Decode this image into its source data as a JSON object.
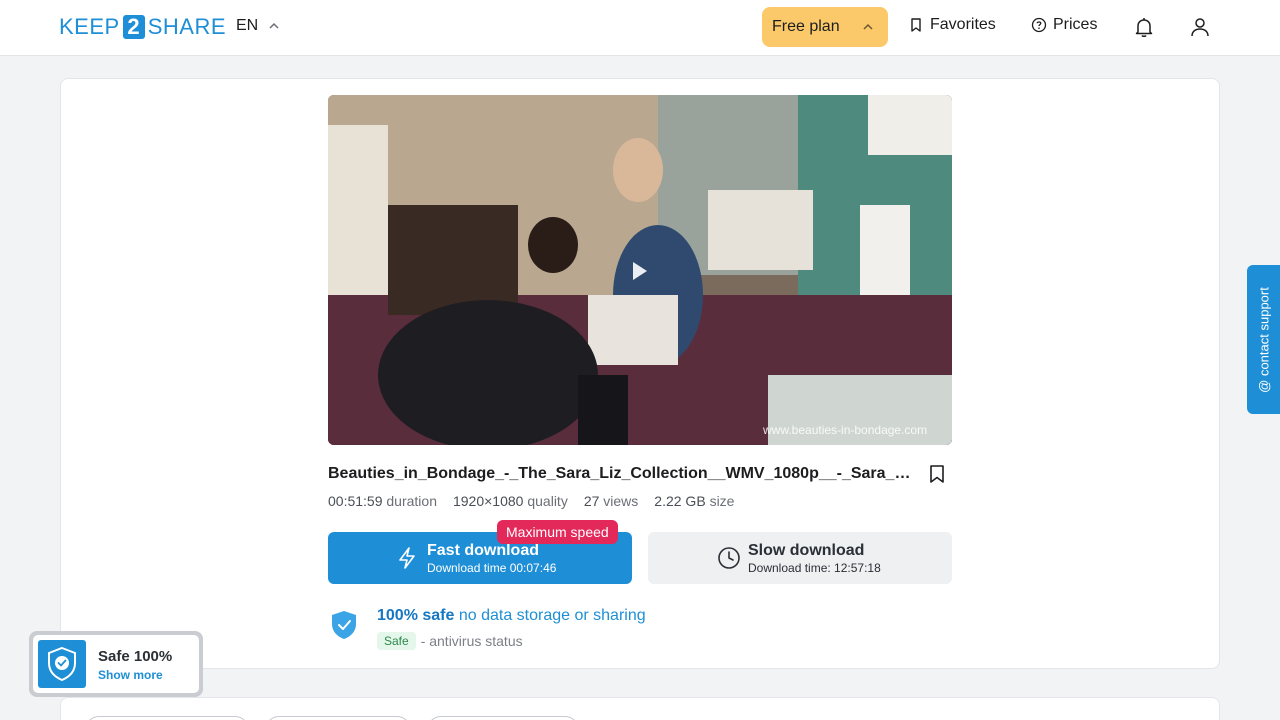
{
  "header": {
    "logo_left": "KEEP",
    "logo_number": "2",
    "logo_right": "SHARE",
    "language": "EN",
    "plan_label": "Free plan",
    "favorites_label": "Favorites",
    "prices_label": "Prices"
  },
  "file": {
    "title": "Beauties_in_Bondage_-_The_Sara_Liz_Collection__WMV_1080p__-_Sara_Liz__...",
    "watermark": "www.beauties-in-bondage.com",
    "duration_value": "00:51:59",
    "duration_label": "duration",
    "quality_value": "1920×1080",
    "quality_label": "quality",
    "views_value": "27",
    "views_label": "views",
    "size_value": "2.22 GB",
    "size_label": "size"
  },
  "download": {
    "badge": "Maximum speed",
    "fast_label": "Fast download",
    "fast_time": "Download time 00:07:46",
    "slow_label": "Slow download",
    "slow_time": "Download time: 12:57:18"
  },
  "safety": {
    "headline_bold": "100% safe",
    "headline_rest": " no data storage or sharing",
    "status_pill": "Safe",
    "status_text": "- antivirus status"
  },
  "support": {
    "label": "@ contact support"
  },
  "safe_badge": {
    "title": "Safe 100%",
    "link": "Show more"
  },
  "colors": {
    "brand": "#1e8fd6",
    "plan": "#fbc969",
    "badge": "#e3285a",
    "safe_green": "#2a8a4a"
  }
}
